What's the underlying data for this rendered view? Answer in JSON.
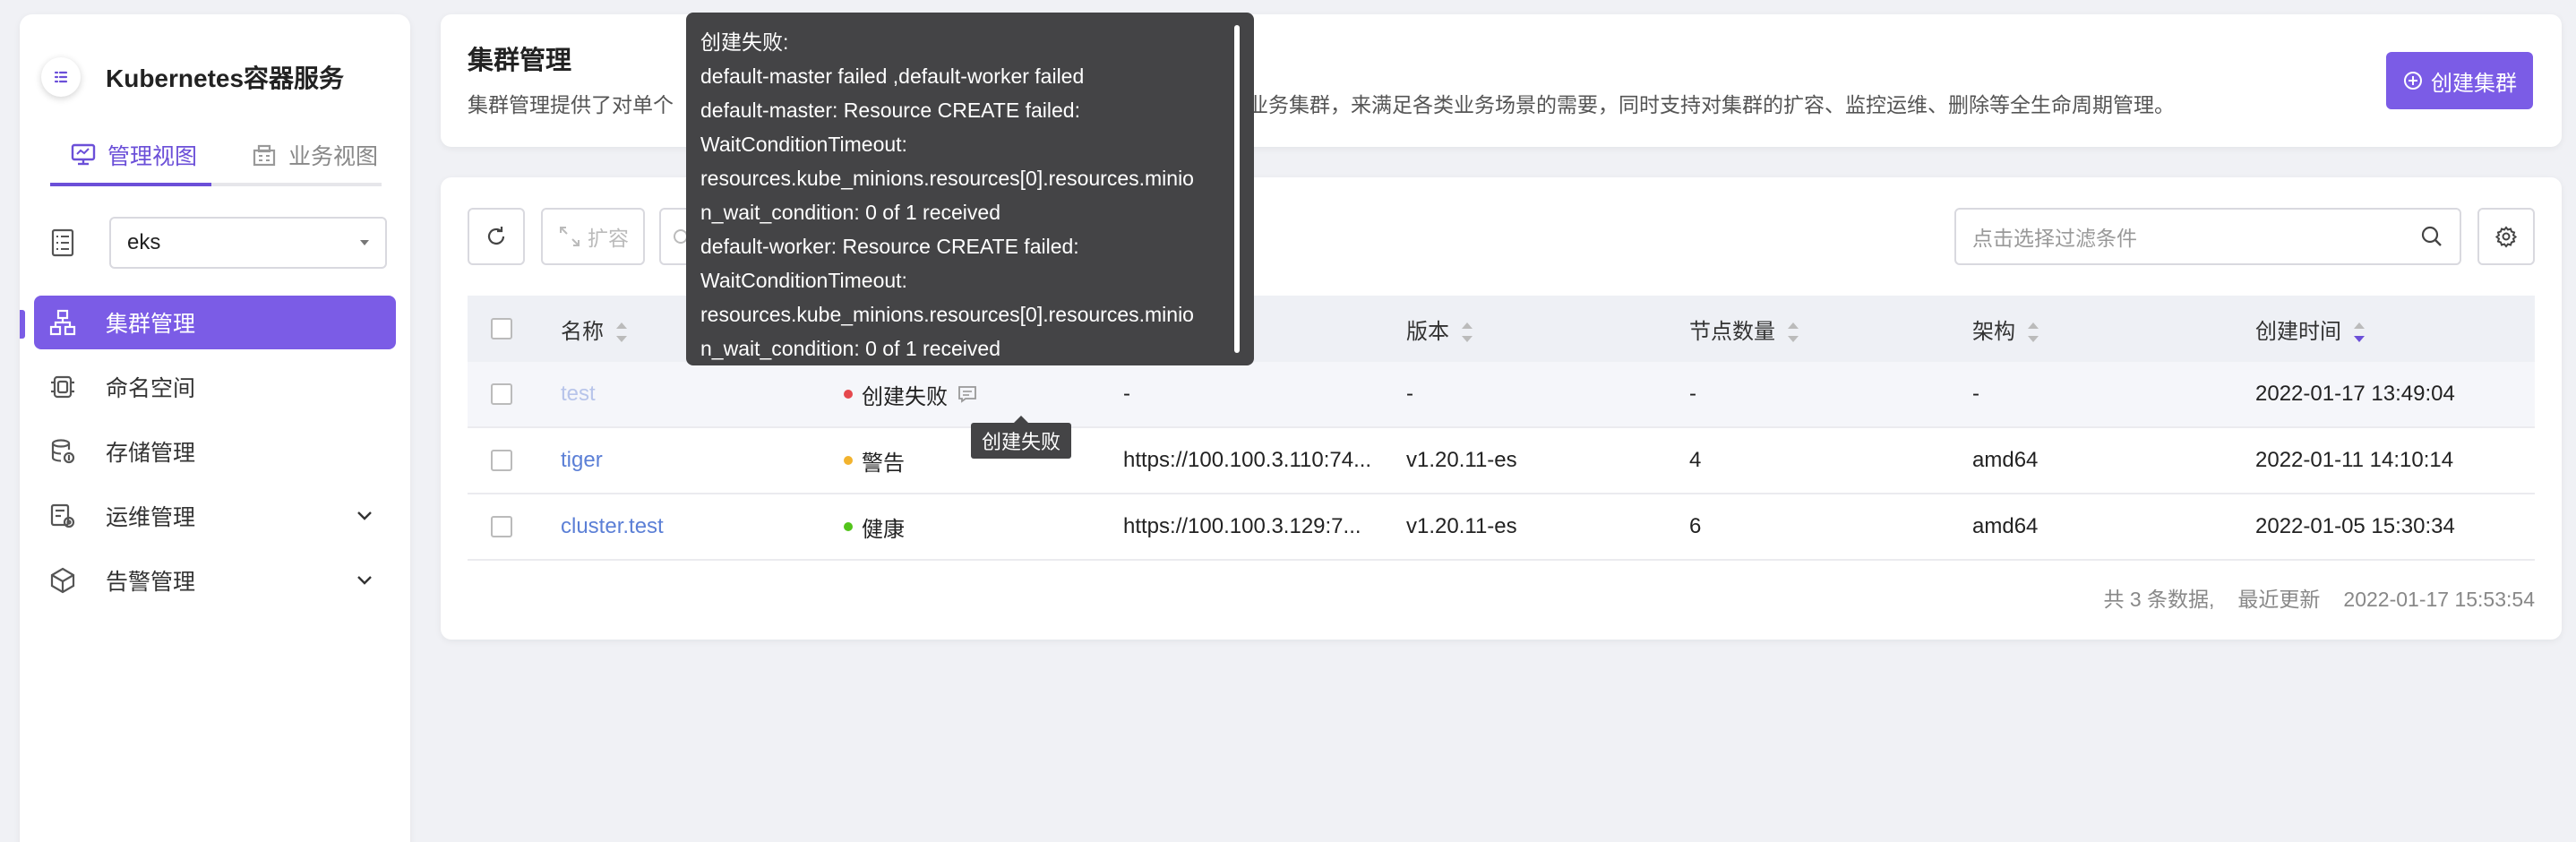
{
  "sidebar": {
    "brand": "Kubernetes容器服务",
    "tabs": [
      {
        "label": "管理视图",
        "active": true
      },
      {
        "label": "业务视图",
        "active": false
      }
    ],
    "namespace": {
      "value": "eks"
    },
    "items": [
      {
        "label": "集群管理",
        "icon": "cluster-icon",
        "active": true
      },
      {
        "label": "命名空间",
        "icon": "namespace-icon"
      },
      {
        "label": "存储管理",
        "icon": "database-icon"
      },
      {
        "label": "运维管理",
        "icon": "ops-icon",
        "expandable": true
      },
      {
        "label": "告警管理",
        "icon": "alert-icon",
        "expandable": true
      }
    ]
  },
  "header": {
    "title": "集群管理",
    "desc_prefix": "集群管理提供了对单个",
    "desc_suffix": "署容器业务集群，来满足各类业务场景的需要，同时支持对集群的扩容、监控运维、删除等全生命周期管理。",
    "create_label": "创建集群"
  },
  "toolbar": {
    "scale_label": "扩容",
    "filter_placeholder": "点击选择过滤条件"
  },
  "table": {
    "columns": [
      "名称",
      "版本",
      "节点数量",
      "架构",
      "创建时间"
    ],
    "rows": [
      {
        "name": "test",
        "status": "创建失败",
        "status_color": "#e5484d",
        "api": "-",
        "version": "-",
        "nodes": "-",
        "arch": "-",
        "created": "2022-01-17 13:49:04"
      },
      {
        "name": "tiger",
        "status": "警告",
        "status_color": "#f2b32e",
        "api": "https://100.100.3.110:74...",
        "version": "v1.20.11-es",
        "nodes": "4",
        "arch": "amd64",
        "created": "2022-01-11 14:10:14"
      },
      {
        "name": "cluster.test",
        "status": "健康",
        "status_color": "#52c41a",
        "api": "https://100.100.3.129:7...",
        "version": "v1.20.11-es",
        "nodes": "6",
        "arch": "amd64",
        "created": "2022-01-05 15:30:34"
      }
    ]
  },
  "footer": {
    "total": "共 3 条数据,",
    "updated_label": "最近更新",
    "updated_time": "2022-01-17 15:53:54"
  },
  "tooltip": {
    "lines": [
      "创建失败:",
      "default-master failed ,default-worker failed",
      "default-master: Resource CREATE failed:",
      "WaitConditionTimeout:",
      "resources.kube_minions.resources[0].resources.minio",
      "n_wait_condition: 0 of 1 received",
      "default-worker: Resource CREATE failed:",
      "WaitConditionTimeout:",
      "resources.kube_minions.resources[0].resources.minio",
      "n_wait_condition: 0 of 1 received"
    ],
    "small": "创建失败"
  },
  "colors": {
    "accent": "#7b5ce6",
    "link": "#5b7fd6",
    "tooltip_bg": "#444446"
  }
}
